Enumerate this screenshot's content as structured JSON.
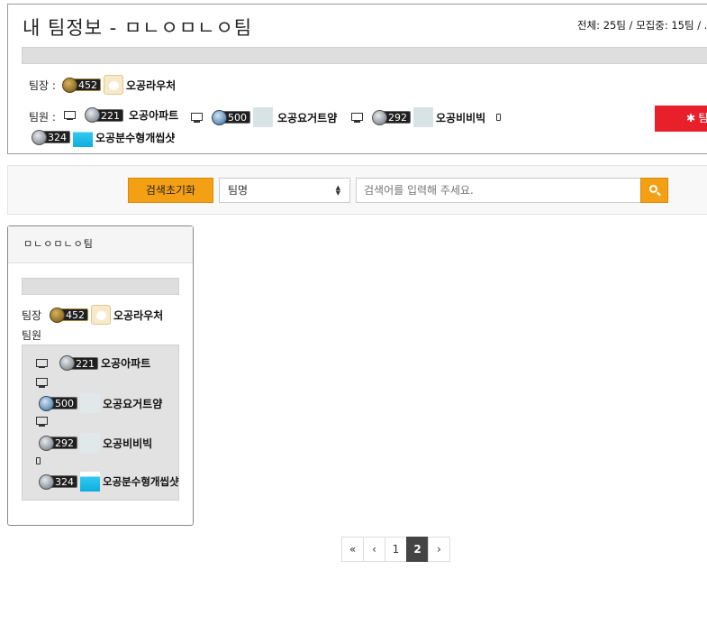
{
  "team_panel": {
    "title": "내 팀정보 - ㅁㄴㅇㅁㄴㅇ팀",
    "stats": "전체: 25팀 / 모집중: 15팀 / .",
    "leader_label": "팀장 :",
    "members_label": "팀원 :",
    "leader": {
      "rank": "452",
      "name": "오공라우처"
    },
    "members": [
      {
        "rank": "221",
        "name": "오공아파트",
        "device": "monitor-icon"
      },
      {
        "rank": "500",
        "name": "오공요거트얌",
        "device": "monitor-icon"
      },
      {
        "rank": "292",
        "name": "오공비비빅",
        "device": "monitor-icon"
      },
      {
        "rank": "324",
        "name": "오공분수형개씹샷",
        "device": "phone-icon"
      }
    ],
    "action_button_label": "팀",
    "action_button_icon": "gear-icon",
    "action_button_color": "#e8202a"
  },
  "search": {
    "reset_label": "검색초기화",
    "select_value": "팀명",
    "placeholder": "검색어를 입력해 주세요.",
    "accent": "#f4a015"
  },
  "card": {
    "title": "ㅁㄴㅇㅁㄴㅇ팀",
    "leader_label": "팀장",
    "members_label": "팀원",
    "leader": {
      "rank": "452",
      "name": "오공라우처"
    },
    "members": [
      {
        "rank": "221",
        "name": "오공아파트"
      },
      {
        "rank": "500",
        "name": "오공요거트얌"
      },
      {
        "rank": "292",
        "name": "오공비비빅"
      },
      {
        "rank": "324",
        "name": "오공분수형개씹샷"
      }
    ]
  },
  "pagination": {
    "first": "«",
    "prev": "‹",
    "pages": [
      "1",
      "2"
    ],
    "current": "2",
    "next": "›"
  }
}
